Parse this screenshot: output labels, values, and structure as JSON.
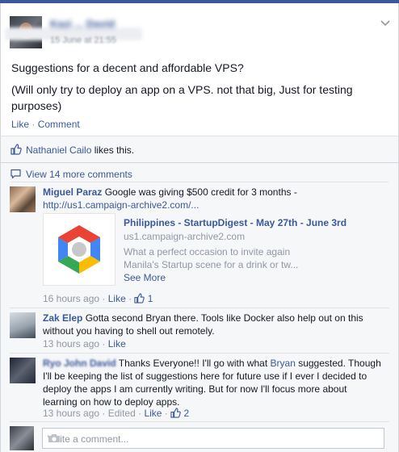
{
  "post": {
    "author": "Kazi ... David",
    "timestamp": "15 June at 21:55",
    "text1": "Suggestions for a decent and affordable VPS?",
    "text2": "(Will only try to deploy an app on a VPS. not that big, Just for testing purposes)",
    "like_label": "Like",
    "comment_label": "Comment",
    "separator": "·",
    "menu_icon": "chevron-down-icon"
  },
  "likes": {
    "liker": "Nathaniel Cailo",
    "suffix": " likes this."
  },
  "comments_header": {
    "view_more": "View 14 more comments"
  },
  "comments": [
    {
      "name": "Miguel Paraz",
      "text": " Google was giving $500 credit for 3 months - ",
      "link": "http://us1.campaign-archive2.com/...",
      "time": "16 hours ago",
      "like_label": "Like",
      "like_count": "1",
      "preview": {
        "title": "Philippines - StartupDigest - May 27th - June 3rd",
        "domain": "us1.campaign-archive2.com",
        "description": "What a perfect occasion to invite again Manila's Startup scene for a drink or tw...",
        "see_more": "See More"
      }
    },
    {
      "name": "Zak Elep",
      "text": " Gotta second Bryan there. Tools like Docker also help out on this without you having to shell out remotely.",
      "time": "13 hours ago",
      "like_label": "Like"
    },
    {
      "name": "Ryo John David",
      "text_before": " Thanks Everyone!! I'll go with what ",
      "mention": "Bryan",
      "text_after": " suggested. Though I'll be keeping the list of suggestions here for future use if I ever I decided to deploy the apps I am currently writing. But for now I'll focus more about learning on how to deploy apps.",
      "time": "13 hours ago",
      "edited": "Edited",
      "like_label": "Like",
      "like_count": "2"
    }
  ],
  "composer": {
    "placeholder": "Write a comment...",
    "camera_icon": "camera-icon"
  },
  "colors": {
    "brand": "#3b5998",
    "meta": "#9197a3",
    "panel": "#f6f7f9"
  }
}
